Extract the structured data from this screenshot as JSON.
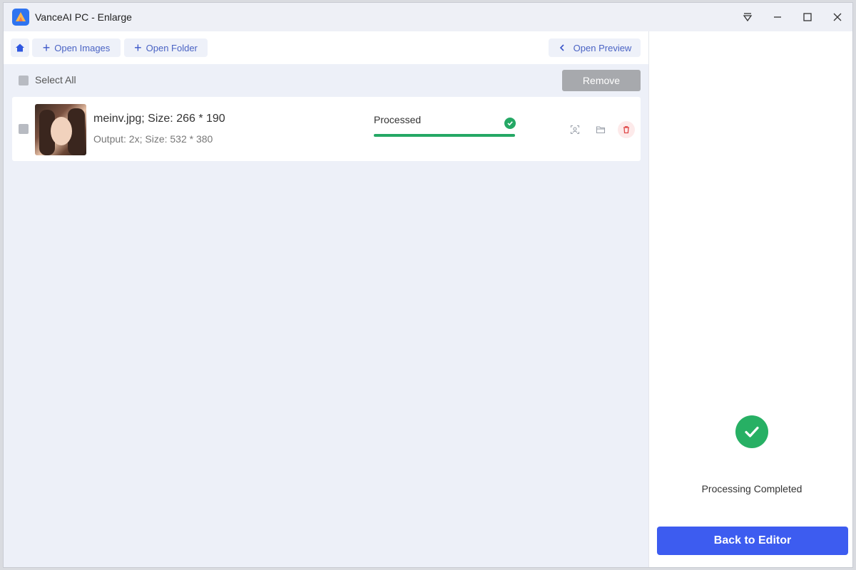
{
  "window": {
    "title": "VanceAI PC - Enlarge",
    "logo_icon": "vanceai-logo-icon",
    "controls": [
      "dropdown-icon",
      "minimize-icon",
      "maximize-icon",
      "close-icon"
    ]
  },
  "toolbar": {
    "home_icon": "home-icon",
    "open_images_label": "Open Images",
    "open_folder_label": "Open Folder",
    "open_preview_label": "Open Preview"
  },
  "list": {
    "select_all_label": "Select All",
    "remove_label": "Remove",
    "items": [
      {
        "name_line": "meinv.jpg; Size: 266 * 190",
        "output_line": "Output: 2x; Size: 532 * 380",
        "status": "Processed",
        "progress": 1.0,
        "actions": [
          "scan-icon",
          "folder-icon",
          "delete-icon"
        ]
      }
    ]
  },
  "panel": {
    "status_text": "Processing Completed",
    "back_label": "Back to Editor"
  },
  "colors": {
    "accent": "#3d5cf0",
    "success": "#25a865",
    "danger": "#e04848"
  }
}
